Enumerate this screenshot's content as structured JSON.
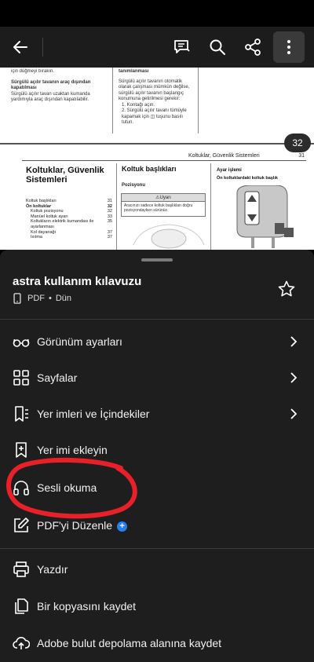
{
  "toolbar": {
    "icons": [
      "back-arrow-icon",
      "comment-icon",
      "search-icon",
      "share-icon",
      "more-vertical-icon"
    ]
  },
  "document": {
    "page_number_badge": "32",
    "page1": {
      "col_a": [
        "için düğmeyi bırakın.",
        "Sürgülü açılır tavanın araç dışından kapatılması",
        "Sürgülü açılır tavan uzaktan kumanda yardımıyla araç dışından kapatılabilir."
      ],
      "col_b": [
        "tanımlanması",
        "Sürgülü açılır tavanın otomatik olarak çalışması mümkün değilse, sürgülü açılır tavanın başlangıç konumuna getirilmesi gerekir:",
        "1. Kontağı açın.",
        "2. Sürgülü açılır tavanı tümüyle kapamak için ◫ tuşunu basılı tutun."
      ]
    },
    "page2": {
      "header_title": "Koltuklar, Güvenlik Sistemleri",
      "header_page": "31",
      "chapter_title": "Koltuklar, Güvenlik Sistemleri",
      "toc": [
        {
          "label": "Koltuk başlıkları",
          "page": "31"
        },
        {
          "label": "Ön koltuklar",
          "page": "32"
        },
        {
          "label": "Koltuk pozisyonu",
          "page": "32"
        },
        {
          "label": "Manüel koltuk ayarı",
          "page": "33"
        },
        {
          "label": "Koltukların elektrik kumandası ile ayarlanması",
          "page": "35"
        },
        {
          "label": "Kol dayanağı",
          "page": "37"
        },
        {
          "label": "Isıtma",
          "page": "37"
        }
      ],
      "section_title": "Koltuk başlıkları",
      "subsection_title": "Pozisyonu",
      "warning_label": "⚠Uyarı",
      "warning_text": "Aracınızı sadece koltuk başlıkları doğru pozisyondayken sürünüz.",
      "right_heading": "Ayar işlemi",
      "right_subheading": "Ön koltuklardaki koltuk başlık"
    }
  },
  "sheet": {
    "file_name": "astra kullanım kılavuzu",
    "file_type": "PDF",
    "file_date": "Dün",
    "menu": [
      {
        "label": "Görünüm ayarları",
        "icon": "glasses-icon",
        "chevron": true
      },
      {
        "label": "Sayfalar",
        "icon": "grid-icon",
        "chevron": true
      },
      {
        "label": "Yer imleri ve İçindekiler",
        "icon": "bookmark-list-icon",
        "chevron": true
      },
      {
        "label": "Yer imi ekleyin",
        "icon": "bookmark-add-icon",
        "chevron": false
      },
      {
        "label": "Sesli okuma",
        "icon": "headphones-icon",
        "chevron": false
      },
      {
        "label": "PDF'yi Düzenle",
        "icon": "edit-icon",
        "chevron": false
      },
      {
        "label": "Yazdır",
        "icon": "printer-icon",
        "chevron": false
      },
      {
        "label": "Bir kopyasını kaydet",
        "icon": "copy-icon",
        "chevron": false
      },
      {
        "label": "Adobe bulut depolama alanına kaydet",
        "icon": "cloud-upload-icon",
        "chevron": false
      }
    ]
  },
  "colors": {
    "sheet_bg": "#1e1e1e",
    "toolbar_bg": "#1c1c1c",
    "annotation": "#e8202a",
    "accent": "#2680eb"
  }
}
